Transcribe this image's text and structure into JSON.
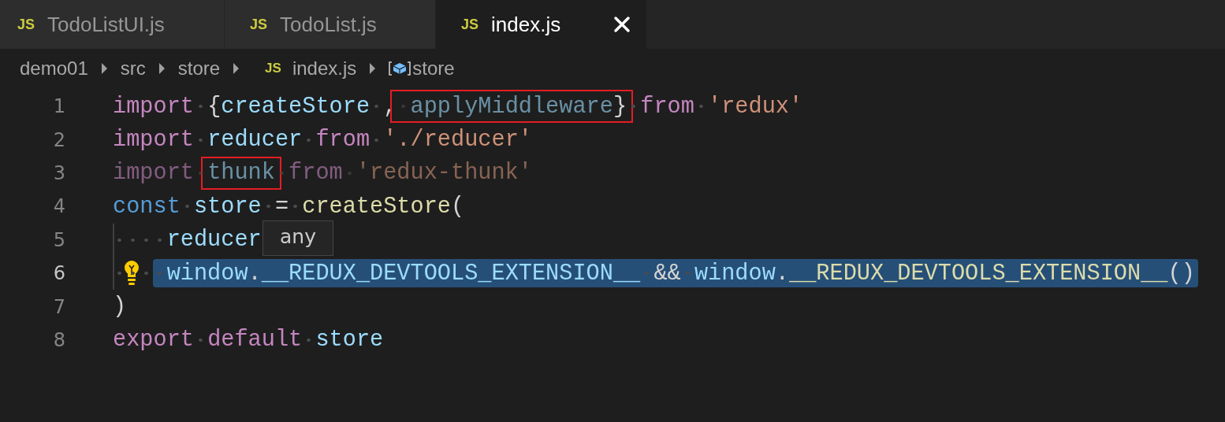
{
  "tabs": [
    {
      "icon": "JS",
      "label": "TodoListUI.js",
      "selected": false,
      "closable": false
    },
    {
      "icon": "JS",
      "label": "TodoList.js",
      "selected": false,
      "closable": false
    },
    {
      "icon": "JS",
      "label": "index.js",
      "selected": true,
      "closable": true
    }
  ],
  "breadcrumb": [
    {
      "kind": "folder",
      "label": "demo01"
    },
    {
      "kind": "folder",
      "label": "src"
    },
    {
      "kind": "folder",
      "label": "store"
    },
    {
      "kind": "file",
      "icon": "JS",
      "label": "index.js"
    },
    {
      "kind": "symbol",
      "label": "store"
    }
  ],
  "editor": {
    "lines": [
      {
        "number": "1",
        "current": false,
        "lightbulb": false,
        "tokens": [
          {
            "text": "import",
            "kind": "keyword"
          },
          {
            "text": " {",
            "kind": "punct"
          },
          {
            "text": "createStore",
            "kind": "variable"
          },
          {
            "text": " ,",
            "kind": "punct"
          },
          {
            "text": " applyMiddleware",
            "kind": "variable",
            "faded": true,
            "boxed": true
          },
          {
            "text": "}",
            "kind": "punct",
            "boxed": true
          },
          {
            "text": " from",
            "kind": "keyword"
          },
          {
            "text": " 'redux'",
            "kind": "string"
          }
        ]
      },
      {
        "number": "2",
        "current": false,
        "lightbulb": false,
        "tokens": [
          {
            "text": "import",
            "kind": "keyword"
          },
          {
            "text": " reducer",
            "kind": "variable"
          },
          {
            "text": " from",
            "kind": "keyword"
          },
          {
            "text": " './reducer'",
            "kind": "string"
          }
        ]
      },
      {
        "number": "3",
        "current": false,
        "lightbulb": false,
        "tokens": [
          {
            "text": "import ",
            "kind": "keyword",
            "faded": true
          },
          {
            "text": "thunk",
            "kind": "variable",
            "faded": true,
            "boxed": true
          },
          {
            "text": " from",
            "kind": "keyword",
            "faded": true
          },
          {
            "text": " 'redux-thunk'",
            "kind": "string",
            "faded": true
          }
        ]
      },
      {
        "number": "4",
        "current": false,
        "lightbulb": false,
        "tokens": [
          {
            "text": "const",
            "kind": "storage"
          },
          {
            "text": " store",
            "kind": "variable"
          },
          {
            "text": " =",
            "kind": "punct"
          },
          {
            "text": " createStore",
            "kind": "function"
          },
          {
            "text": "(",
            "kind": "punct"
          }
        ]
      },
      {
        "number": "5",
        "current": false,
        "lightbulb": false,
        "tokens": [
          {
            "text": "    reducer",
            "kind": "variable"
          }
        ]
      },
      {
        "number": "6",
        "current": true,
        "lightbulb": true,
        "tokens": [
          {
            "text": "    window",
            "kind": "variable",
            "selected": true
          },
          {
            "text": ".",
            "kind": "punct",
            "selected": true
          },
          {
            "text": "__REDUX_DEVTOOLS_EXTENSION__",
            "kind": "variable",
            "selected": true
          },
          {
            "text": " &&",
            "kind": "punct",
            "selected": true
          },
          {
            "text": " window",
            "kind": "variable",
            "selected": true
          },
          {
            "text": ".",
            "kind": "punct",
            "selected": true
          },
          {
            "text": "__REDUX_DEVTOOLS_EXTENSION__",
            "kind": "function",
            "selected": true
          },
          {
            "text": "()",
            "kind": "punct",
            "selected": true
          }
        ]
      },
      {
        "number": "7",
        "current": false,
        "lightbulb": false,
        "tokens": [
          {
            "text": ")",
            "kind": "punct"
          }
        ]
      },
      {
        "number": "8",
        "current": false,
        "lightbulb": false,
        "tokens": [
          {
            "text": "export",
            "kind": "keyword"
          },
          {
            "text": " default",
            "kind": "keyword"
          },
          {
            "text": " store",
            "kind": "variable"
          }
        ]
      }
    ]
  },
  "hover": {
    "text": "any"
  }
}
